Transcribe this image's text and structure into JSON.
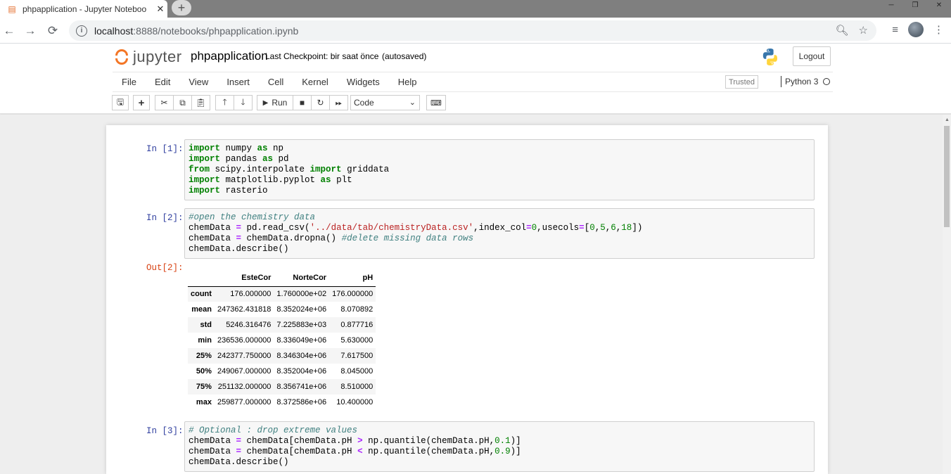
{
  "browser": {
    "tab_title": "phpapplication - Jupyter Noteboo",
    "tab_close": "✕",
    "new_tab": "+",
    "url_host": "localhost",
    "url_path": ":8888/notebooks/phpapplication.ipynb",
    "window_controls": [
      "─",
      "❐",
      "✕"
    ]
  },
  "jupyter": {
    "logo_text": "jupyter",
    "notebook_name": "phpapplication",
    "checkpoint": "Last Checkpoint: bir saat önce",
    "autosaved": "(autosaved)",
    "logout": "Logout",
    "menu": [
      "File",
      "Edit",
      "View",
      "Insert",
      "Cell",
      "Kernel",
      "Widgets",
      "Help"
    ],
    "trusted": "Trusted",
    "kernel": "Python 3",
    "toolbar": {
      "run_label": "Run",
      "cell_type": "Code"
    }
  },
  "cells": {
    "c1": {
      "prompt": "In [1]:"
    },
    "c2": {
      "prompt": "In [2]:",
      "out_prompt": "Out[2]:"
    },
    "c3": {
      "prompt": "In [3]:"
    }
  },
  "describe_table": {
    "columns": [
      "",
      "EsteCor",
      "NorteCor",
      "pH"
    ],
    "rows": [
      [
        "count",
        "176.000000",
        "1.760000e+02",
        "176.000000"
      ],
      [
        "mean",
        "247362.431818",
        "8.352024e+06",
        "8.070892"
      ],
      [
        "std",
        "5246.316476",
        "7.225883e+03",
        "0.877716"
      ],
      [
        "min",
        "236536.000000",
        "8.336049e+06",
        "5.630000"
      ],
      [
        "25%",
        "242377.750000",
        "8.346304e+06",
        "7.617500"
      ],
      [
        "50%",
        "249067.000000",
        "8.352004e+06",
        "8.045000"
      ],
      [
        "75%",
        "251132.000000",
        "8.356741e+06",
        "8.510000"
      ],
      [
        "max",
        "259877.000000",
        "8.372586e+06",
        "10.400000"
      ]
    ]
  }
}
